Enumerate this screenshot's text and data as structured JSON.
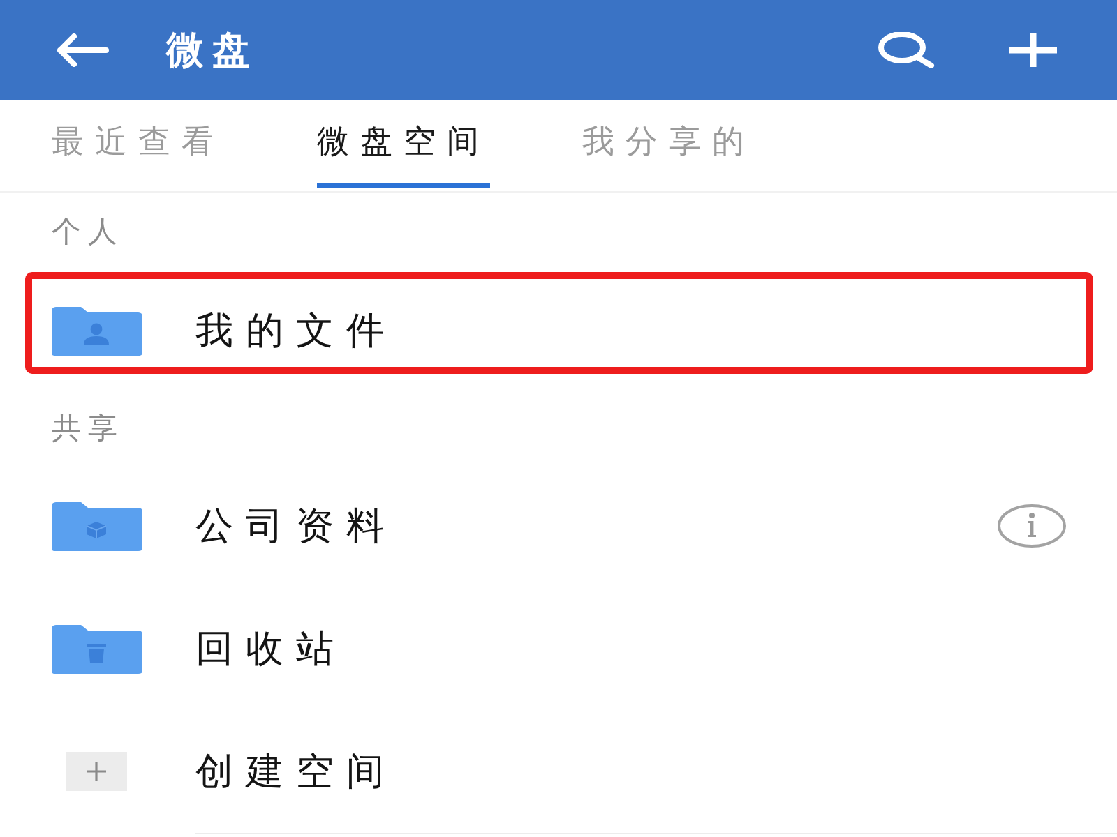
{
  "app_bar": {
    "title": "微盘"
  },
  "tabs": [
    {
      "label": "最近查看",
      "selected": false
    },
    {
      "label": "微盘空间",
      "selected": true
    },
    {
      "label": "我分享的",
      "selected": false
    }
  ],
  "sections": [
    {
      "heading": "个人",
      "items": [
        {
          "kind": "personal",
          "label": "我的文件",
          "highlighted": true,
          "info": false
        }
      ]
    },
    {
      "heading": "共享",
      "items": [
        {
          "kind": "shared",
          "label": "公司资料",
          "highlighted": false,
          "info": true
        },
        {
          "kind": "recycle",
          "label": "回收站",
          "highlighted": false,
          "info": false
        },
        {
          "kind": "create",
          "label": "创建空间",
          "highlighted": false,
          "info": false
        }
      ]
    }
  ]
}
